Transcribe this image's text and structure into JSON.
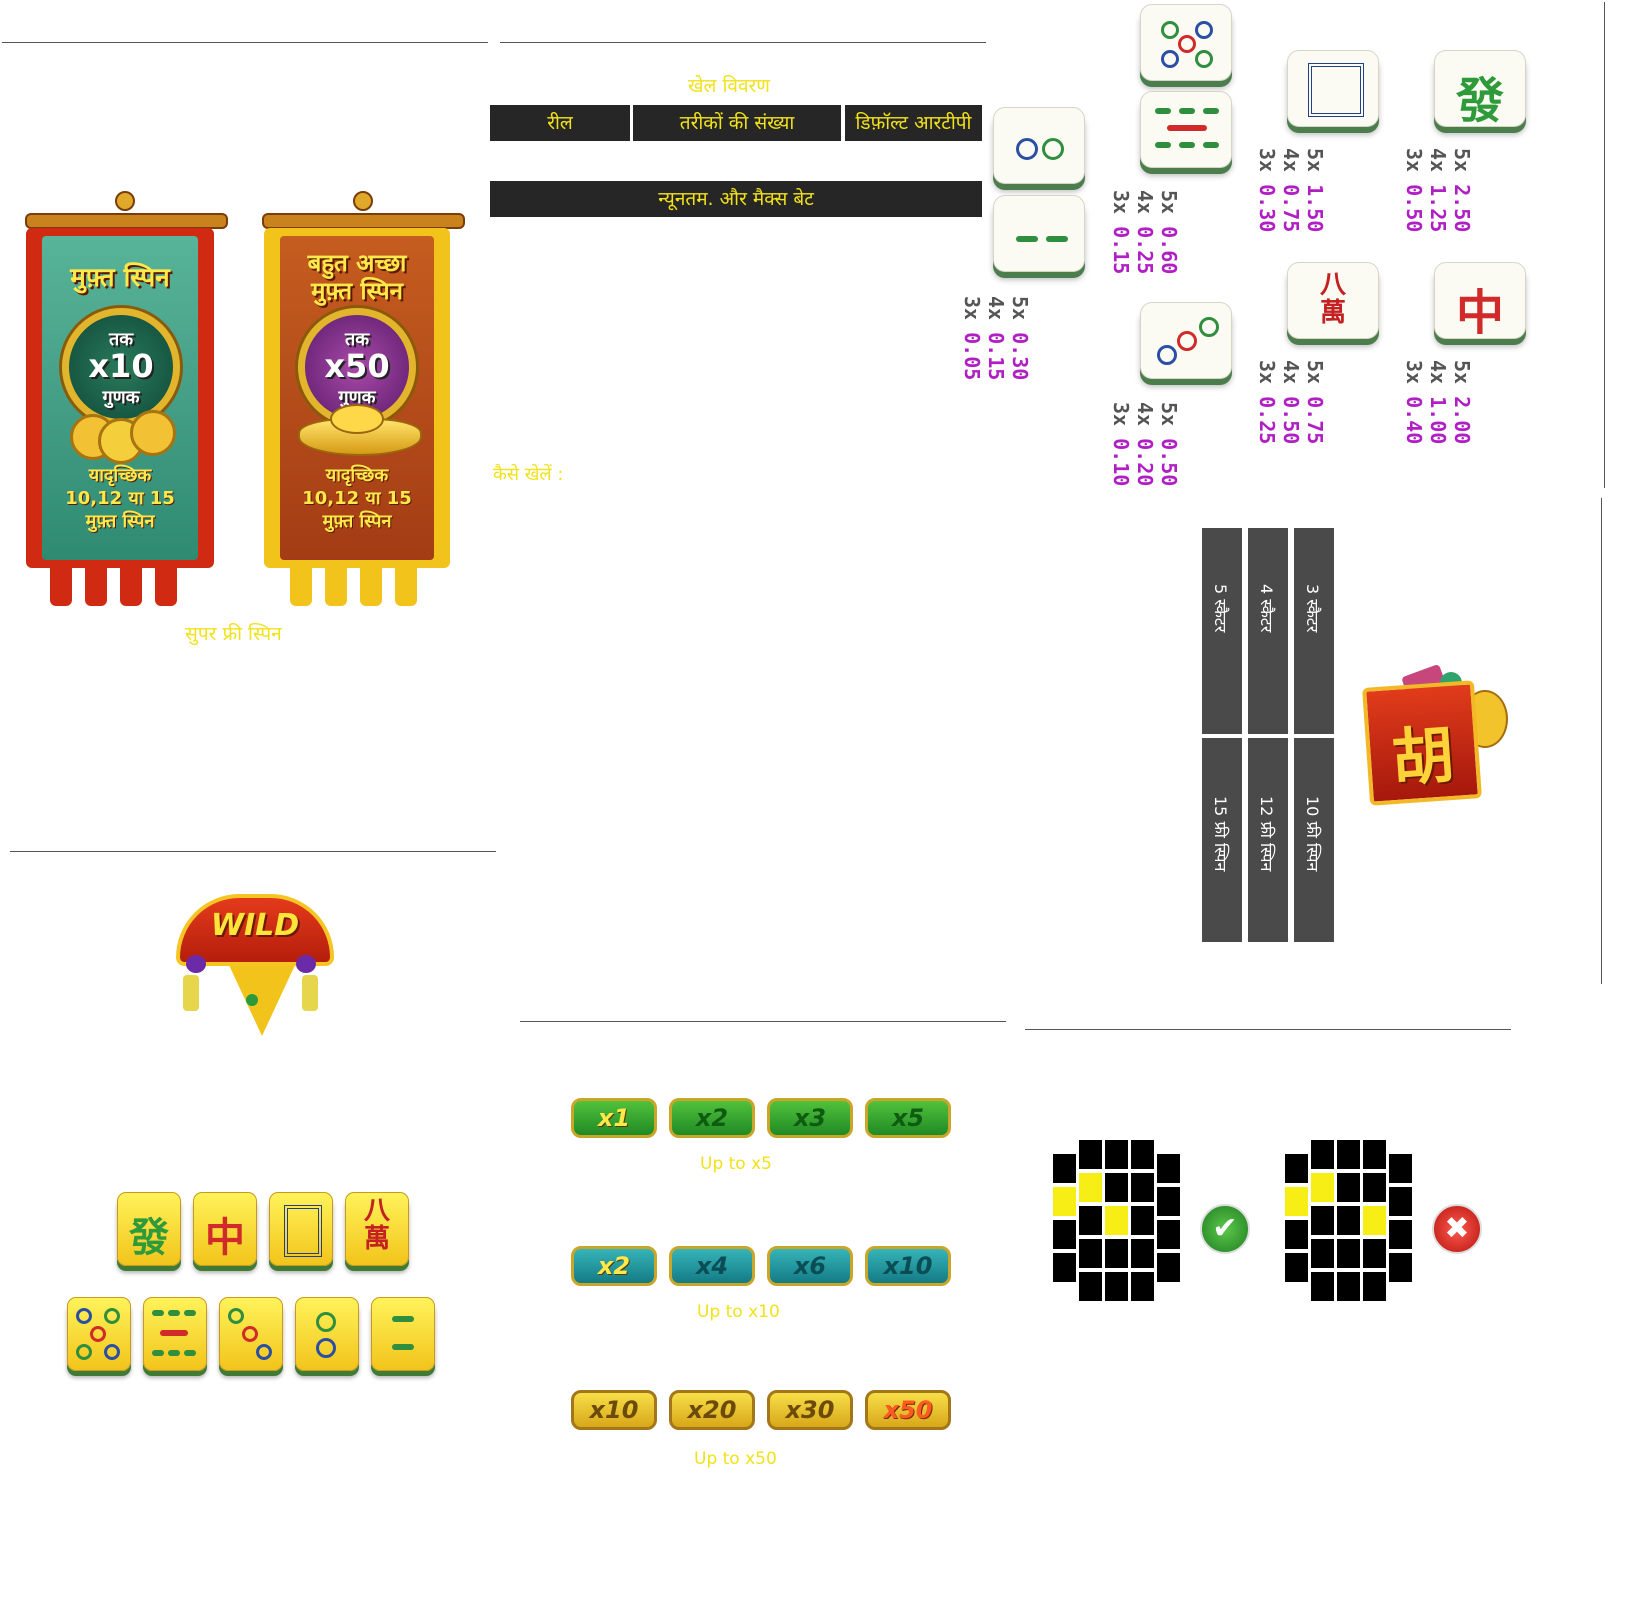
{
  "colors": {
    "accent_yellow": "#f2e21a",
    "payout_purple": "#b01fc4",
    "dark_bar": "#262626",
    "scatter_column": "#4a4a4a"
  },
  "super_free_spins": {
    "caption": "सुपर फ्री स्पिन",
    "banner_left": {
      "title": "मुफ़्त स्पिन",
      "medal_top": "तक",
      "medal_value": "x10",
      "medal_bottom": "गुणक",
      "foot_line1": "यादृच्छिक",
      "foot_line2": "10,12 या 15",
      "foot_line3": "मुफ़्त स्पिन"
    },
    "banner_right": {
      "title_line1": "बहुत अच्छा",
      "title_line2": "मुफ़्त स्पिन",
      "medal_top": "तक",
      "medal_value": "x50",
      "medal_bottom": "गुणक",
      "foot_line1": "यादृच्छिक",
      "foot_line2": "10,12 या 15",
      "foot_line3": "मुफ़्त स्पिन"
    }
  },
  "game_info": {
    "heading": "खेल विवरण",
    "headers": [
      "रील",
      "तरीकों की संख्या",
      "डिफ़ॉल्ट आरटीपी"
    ],
    "bet_bar": "न्यूनतम. और मैक्स बेट",
    "how_to_play": "कैसे खेलें :"
  },
  "paytable": [
    {
      "symbol": "two-dots-tile",
      "lines": [
        "5x 0.30",
        "4x 0.15",
        "3x 0.05"
      ]
    },
    {
      "symbol": "two-bamboo-tile",
      "lines": []
    },
    {
      "symbol": "five-dots-tile",
      "lines": []
    },
    {
      "symbol": "eight-bamboo-tile",
      "lines": [
        "5x 0.60",
        "4x 0.25",
        "3x 0.15"
      ]
    },
    {
      "symbol": "three-dots-tile",
      "lines": [
        "5x 0.50",
        "4x 0.20",
        "3x 0.10"
      ]
    },
    {
      "symbol": "white-dragon-tile",
      "lines": [
        "5x 1.50",
        "4x 0.75",
        "3x 0.30"
      ]
    },
    {
      "symbol": "green-dragon-tile",
      "lines": [
        "5x 2.50",
        "4x 1.25",
        "3x 0.50"
      ]
    },
    {
      "symbol": "eight-wan-tile",
      "lines": [
        "5x 0.75",
        "4x 0.50",
        "3x 0.25"
      ]
    },
    {
      "symbol": "red-dragon-tile",
      "lines": [
        "5x 2.00",
        "4x 1.00",
        "3x 0.40"
      ]
    }
  ],
  "pay": {
    "c1": {
      "m5": "5x",
      "v5": "0.30",
      "m4": "4x",
      "v4": "0.15",
      "m3": "3x",
      "v3": "0.05"
    },
    "c2": {
      "m5": "5x",
      "v5": "0.60",
      "m4": "4x",
      "v4": "0.25",
      "m3": "3x",
      "v3": "0.15"
    },
    "c3": {
      "m5": "5x",
      "v5": "0.50",
      "m4": "4x",
      "v4": "0.20",
      "m3": "3x",
      "v3": "0.10"
    },
    "c4": {
      "m5": "5x",
      "v5": "1.50",
      "m4": "4x",
      "v4": "0.75",
      "m3": "3x",
      "v3": "0.30"
    },
    "c5": {
      "m5": "5x",
      "v5": "2.50",
      "m4": "4x",
      "v4": "1.25",
      "m3": "3x",
      "v3": "0.50"
    },
    "c6": {
      "m5": "5x",
      "v5": "0.75",
      "m4": "4x",
      "v4": "0.50",
      "m3": "3x",
      "v3": "0.25"
    },
    "c7": {
      "m5": "5x",
      "v5": "2.00",
      "m4": "4x",
      "v4": "1.00",
      "m3": "3x",
      "v3": "0.40"
    }
  },
  "scatter": {
    "cols": [
      {
        "top": "5 स्कैटर",
        "bottom": "15 फ्री स्पिन"
      },
      {
        "top": "4 स्कैटर",
        "bottom": "12 फ्री स्पिन"
      },
      {
        "top": "3 स्कैटर",
        "bottom": "10 फ्री स्पिन"
      }
    ],
    "symbol_glyph": "胡"
  },
  "wild": {
    "label": "WILD"
  },
  "gold_tiles": [
    "發",
    "中",
    "",
    "八萬"
  ],
  "multipliers": {
    "row1": {
      "pills": [
        "x1",
        "x2",
        "x3",
        "x5"
      ],
      "caption": "Up to x5"
    },
    "row2": {
      "pills": [
        "x2",
        "x4",
        "x6",
        "x10"
      ],
      "caption": "Up to x10"
    },
    "row3": {
      "pills": [
        "x10",
        "x20",
        "x30",
        "x50"
      ],
      "caption": "Up to x50"
    }
  },
  "patterns": {
    "valid_icon": "✔",
    "invalid_icon": "✖"
  }
}
